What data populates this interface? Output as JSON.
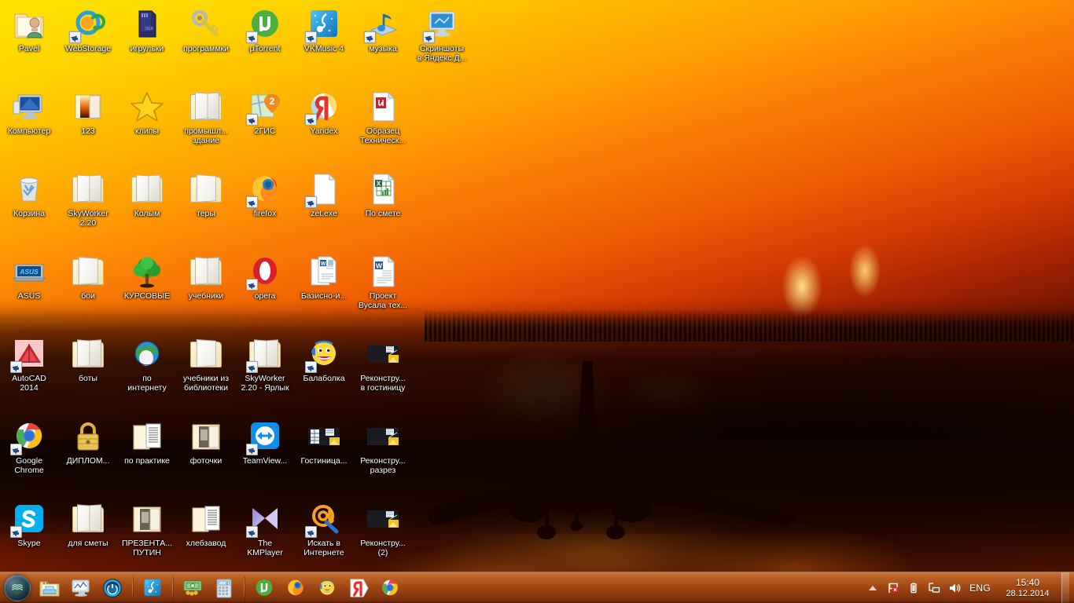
{
  "desktop": {
    "wallpaper_description": "Airplane landing silhouette against orange sunset with wildfire",
    "grid": {
      "col_start": 0,
      "col_step": 75,
      "row_start": 8,
      "row_step": 105,
      "columns": 7
    },
    "icons": [
      {
        "label": "Pavel",
        "icon": "folder-user-icon",
        "type": "folder-user",
        "shortcut": false,
        "col": 0,
        "row": 0
      },
      {
        "label": "WebStorage",
        "icon": "webstorage-sync-icon",
        "type": "webstorage",
        "shortcut": true,
        "col": 1,
        "row": 0
      },
      {
        "label": "игрульки",
        "icon": "sd-card-icon",
        "type": "sdcard",
        "shortcut": false,
        "col": 2,
        "row": 0
      },
      {
        "label": "программки",
        "icon": "key-icon",
        "type": "key",
        "shortcut": false,
        "col": 3,
        "row": 0
      },
      {
        "label": "µTorrent",
        "icon": "utorrent-icon",
        "type": "utorrent",
        "shortcut": true,
        "col": 4,
        "row": 0
      },
      {
        "label": "VKMusic 4",
        "icon": "vkmusic-icon",
        "type": "vkmusic",
        "shortcut": true,
        "col": 5,
        "row": 0
      },
      {
        "label": "музыка",
        "icon": "music-note-icon",
        "type": "musicnote",
        "shortcut": true,
        "col": 6,
        "row": 0
      },
      {
        "label": "Скриншоты\nв Яндекс.Д...",
        "icon": "screenshot-monitor-icon",
        "type": "monitorshot",
        "shortcut": true,
        "col": 7,
        "row": 0
      },
      {
        "label": "Компьютер",
        "icon": "computer-icon",
        "type": "computer",
        "shortcut": false,
        "col": 0,
        "row": 1
      },
      {
        "label": "123",
        "icon": "folder-image-icon",
        "type": "folder-img",
        "shortcut": false,
        "col": 1,
        "row": 1
      },
      {
        "label": "клипы",
        "icon": "star-icon",
        "type": "star",
        "shortcut": false,
        "col": 2,
        "row": 1
      },
      {
        "label": "промышл...\nздание",
        "icon": "folder-icon",
        "type": "folder",
        "shortcut": false,
        "col": 3,
        "row": 1
      },
      {
        "label": "2ГИС",
        "icon": "2gis-map-icon",
        "type": "gis",
        "shortcut": true,
        "col": 4,
        "row": 1
      },
      {
        "label": "Yandex",
        "icon": "yandex-browser-icon",
        "type": "yandex",
        "shortcut": true,
        "col": 5,
        "row": 1
      },
      {
        "label": "Образец\nТехническ...",
        "icon": "document-red-icon",
        "type": "doc-red",
        "shortcut": false,
        "col": 6,
        "row": 1
      },
      {
        "label": "Корзина",
        "icon": "recycle-bin-icon",
        "type": "recyclebin",
        "shortcut": false,
        "col": 0,
        "row": 2
      },
      {
        "label": "SkyWorker\n2.20",
        "icon": "folder-icon",
        "type": "folder",
        "shortcut": false,
        "col": 1,
        "row": 2
      },
      {
        "label": "Колым",
        "icon": "folder-icon",
        "type": "folder",
        "shortcut": false,
        "col": 2,
        "row": 2
      },
      {
        "label": "теры",
        "icon": "folder-icon",
        "type": "folder-plain",
        "shortcut": false,
        "col": 3,
        "row": 2
      },
      {
        "label": "firefox",
        "icon": "firefox-icon",
        "type": "firefox",
        "shortcut": true,
        "col": 4,
        "row": 2
      },
      {
        "label": "zet.exe",
        "icon": "blank-document-icon",
        "type": "doc-blank",
        "shortcut": true,
        "col": 5,
        "row": 2
      },
      {
        "label": "По смете",
        "icon": "excel-document-icon",
        "type": "excel",
        "shortcut": false,
        "col": 6,
        "row": 2
      },
      {
        "label": "ASUS",
        "icon": "asus-laptop-icon",
        "type": "asus",
        "shortcut": false,
        "col": 0,
        "row": 3
      },
      {
        "label": "бои",
        "icon": "folder-icon",
        "type": "folder-plain",
        "shortcut": false,
        "col": 1,
        "row": 3
      },
      {
        "label": "КУРСОВЫЕ",
        "icon": "tree-icon",
        "type": "tree",
        "shortcut": false,
        "col": 2,
        "row": 3
      },
      {
        "label": "учебники",
        "icon": "folder-icon",
        "type": "folder",
        "shortcut": false,
        "col": 3,
        "row": 3
      },
      {
        "label": "opera",
        "icon": "opera-icon",
        "type": "opera",
        "shortcut": true,
        "col": 4,
        "row": 3
      },
      {
        "label": "Базисно-и...",
        "icon": "word-document-icon",
        "type": "word2",
        "shortcut": false,
        "col": 5,
        "row": 3
      },
      {
        "label": "Проект\nВусала тех...",
        "icon": "word-document-icon",
        "type": "word",
        "shortcut": false,
        "col": 6,
        "row": 3
      },
      {
        "label": "AutoCAD\n2014",
        "icon": "autocad-icon",
        "type": "autocad",
        "shortcut": true,
        "col": 0,
        "row": 4
      },
      {
        "label": "боты",
        "icon": "folder-icon",
        "type": "folder",
        "shortcut": false,
        "col": 1,
        "row": 4
      },
      {
        "label": "по\nинтернету",
        "icon": "globe-folder-icon",
        "type": "globe",
        "shortcut": false,
        "col": 2,
        "row": 4
      },
      {
        "label": "учебники из\nбиблиотеки",
        "icon": "folder-icon",
        "type": "folder-plain",
        "shortcut": false,
        "col": 3,
        "row": 4
      },
      {
        "label": "SkyWorker\n2.20 - Ярлык",
        "icon": "folder-icon",
        "type": "folder",
        "shortcut": true,
        "col": 4,
        "row": 4
      },
      {
        "label": "Балаболка",
        "icon": "balabolka-smiley-icon",
        "type": "balabolka",
        "shortcut": true,
        "col": 5,
        "row": 4
      },
      {
        "label": "Реконстру...\nв гостиницу",
        "icon": "cad-drawing-icon",
        "type": "cadfile",
        "shortcut": false,
        "col": 6,
        "row": 4
      },
      {
        "label": "Google\nChrome",
        "icon": "chrome-icon",
        "type": "chrome",
        "shortcut": true,
        "col": 0,
        "row": 5
      },
      {
        "label": "ДИПЛОМ...",
        "icon": "padlock-icon",
        "type": "lock",
        "shortcut": false,
        "col": 1,
        "row": 5
      },
      {
        "label": "по практике",
        "icon": "folder-doc-icon",
        "type": "folder-doc",
        "shortcut": false,
        "col": 2,
        "row": 5
      },
      {
        "label": "фоточки",
        "icon": "folder-photo-icon",
        "type": "folder-photo",
        "shortcut": false,
        "col": 3,
        "row": 5
      },
      {
        "label": "TeamView...",
        "icon": "teamviewer-icon",
        "type": "teamviewer",
        "shortcut": true,
        "col": 4,
        "row": 5
      },
      {
        "label": "Гостиница...",
        "icon": "cad-drawing-icon",
        "type": "cadfile2",
        "shortcut": false,
        "col": 5,
        "row": 5
      },
      {
        "label": "Реконстру...\nразрез",
        "icon": "cad-drawing-icon",
        "type": "cadfile",
        "shortcut": false,
        "col": 6,
        "row": 5
      },
      {
        "label": "Skype",
        "icon": "skype-icon",
        "type": "skype",
        "shortcut": true,
        "col": 0,
        "row": 6
      },
      {
        "label": "для сметы",
        "icon": "folder-icon",
        "type": "folder",
        "shortcut": false,
        "col": 1,
        "row": 6
      },
      {
        "label": "ПРЕЗЕНТА...\nПУТИН",
        "icon": "folder-photo-icon",
        "type": "folder-photo",
        "shortcut": false,
        "col": 2,
        "row": 6
      },
      {
        "label": "хлебзавод",
        "icon": "folder-doc-icon",
        "type": "folder-doc",
        "shortcut": false,
        "col": 3,
        "row": 6
      },
      {
        "label": "The\nKMPlayer",
        "icon": "kmplayer-icon",
        "type": "kmplayer",
        "shortcut": true,
        "col": 4,
        "row": 6
      },
      {
        "label": "Искать в\nИнтернете",
        "icon": "at-search-icon",
        "type": "atsearch",
        "shortcut": true,
        "col": 5,
        "row": 6
      },
      {
        "label": "Реконстру...\n(2)",
        "icon": "cad-drawing-icon",
        "type": "cadfile",
        "shortcut": false,
        "col": 6,
        "row": 6
      }
    ]
  },
  "taskbar": {
    "start_button_label": "Пуск",
    "pinned": [
      {
        "name": "explorer",
        "icon": "file-explorer-icon",
        "sep_before": false
      },
      {
        "name": "monitor",
        "icon": "monitor-chart-icon",
        "sep_before": false
      },
      {
        "name": "antivirus",
        "icon": "blue-shield-orb-icon",
        "sep_before": false
      },
      {
        "name": "vkmusic",
        "icon": "vkmusic-icon",
        "sep_before": true
      },
      {
        "name": "money",
        "icon": "money-cash-icon",
        "sep_before": true
      },
      {
        "name": "calculator",
        "icon": "calculator-icon",
        "sep_before": false
      },
      {
        "name": "utorrent",
        "icon": "utorrent-icon",
        "sep_before": true
      },
      {
        "name": "firefox",
        "icon": "firefox-icon",
        "sep_before": false
      },
      {
        "name": "balabolka",
        "icon": "balabolka-smiley-icon",
        "sep_before": false
      },
      {
        "name": "yandex",
        "icon": "yandex-logo-icon",
        "sep_before": false
      },
      {
        "name": "chrome",
        "icon": "chrome-icon",
        "sep_before": false
      }
    ],
    "tray": {
      "overflow_icon": "chevron-up-icon",
      "icons": [
        {
          "name": "action-center",
          "icon": "flag-alert-icon"
        },
        {
          "name": "battery",
          "icon": "battery-icon"
        },
        {
          "name": "network",
          "icon": "network-icon"
        },
        {
          "name": "volume",
          "icon": "speaker-icon"
        }
      ],
      "language": "ENG",
      "time": "15:40",
      "date": "28.12.2014"
    }
  },
  "colors": {
    "taskbar_base": "#a9501b",
    "wallpaper_top": "#ffe400",
    "wallpaper_mid": "#ef5c04",
    "wallpaper_bottom": "#2a0800",
    "label_text": "#ffffff"
  }
}
